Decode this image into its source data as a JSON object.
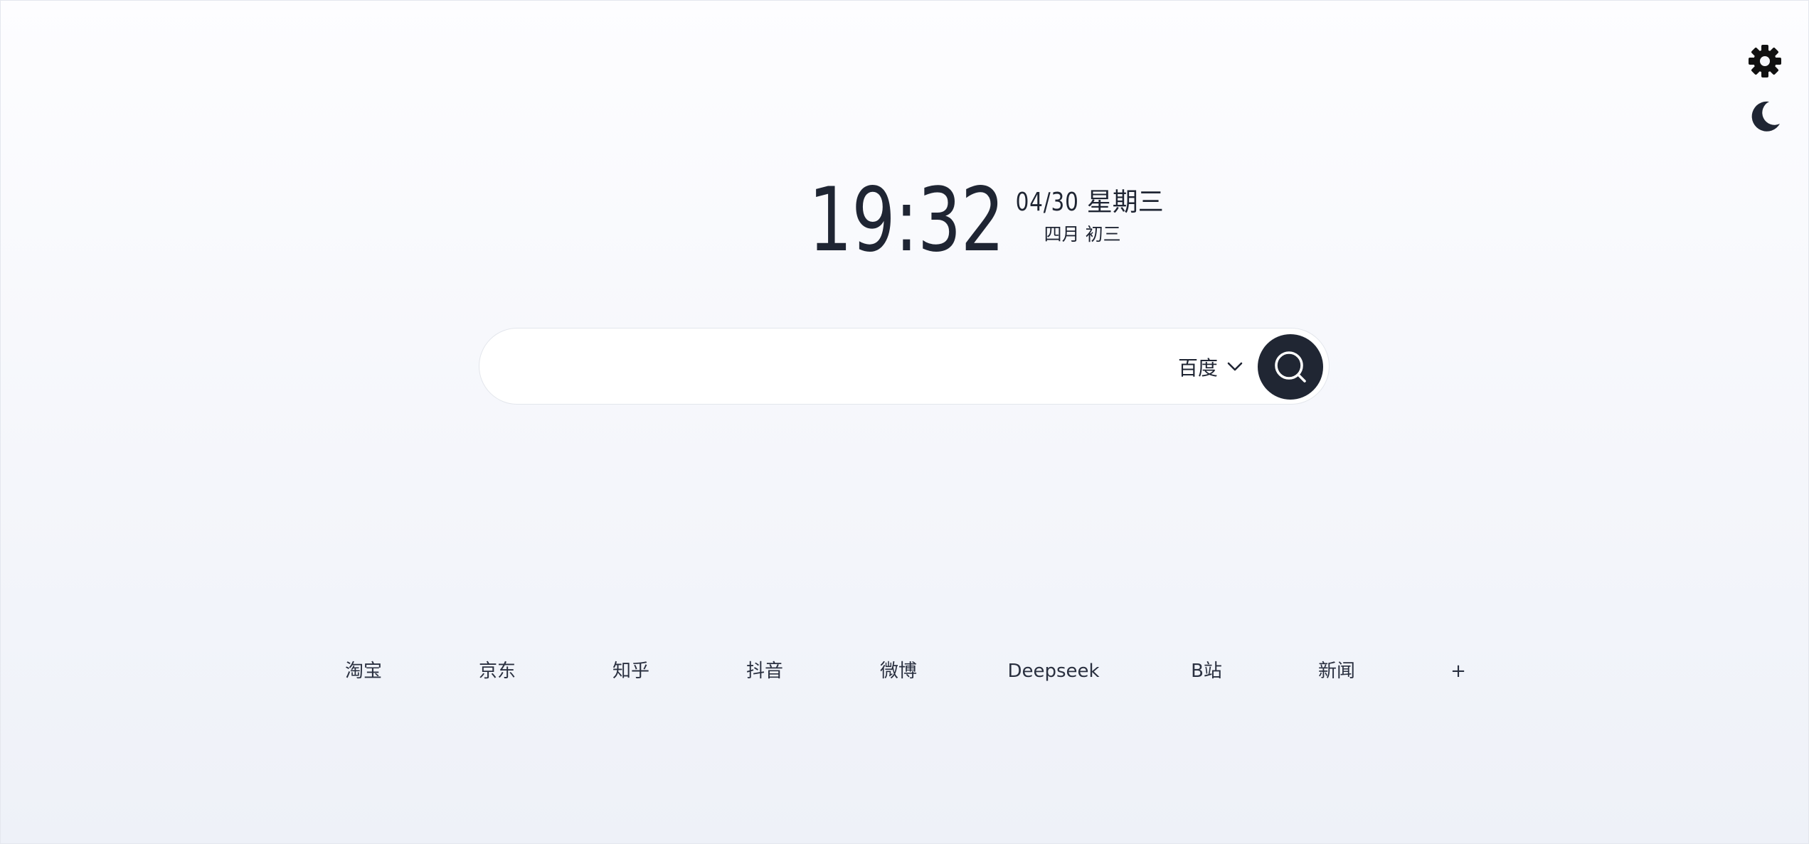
{
  "header": {
    "settings_icon": "gear-icon",
    "theme_icon": "moon-icon"
  },
  "clock": {
    "time": "19:32",
    "date": "04/30",
    "weekday": "星期三",
    "lunar_month": "四月",
    "lunar_day": "初三"
  },
  "search": {
    "value": "",
    "placeholder": "",
    "engine_label": "百度",
    "engine_icon": "chevron-down-icon",
    "button_icon": "search-icon"
  },
  "quick_links": [
    {
      "label": "淘宝"
    },
    {
      "label": "京东"
    },
    {
      "label": "知乎"
    },
    {
      "label": "抖音"
    },
    {
      "label": "微博"
    },
    {
      "label": "Deepseek"
    },
    {
      "label": "B站"
    },
    {
      "label": "新闻"
    },
    {
      "label": "+"
    }
  ],
  "colors": {
    "text": "#1f2533",
    "search_button": "#202633",
    "background_top": "#fdfdff",
    "background_bottom": "#eef1f8"
  }
}
